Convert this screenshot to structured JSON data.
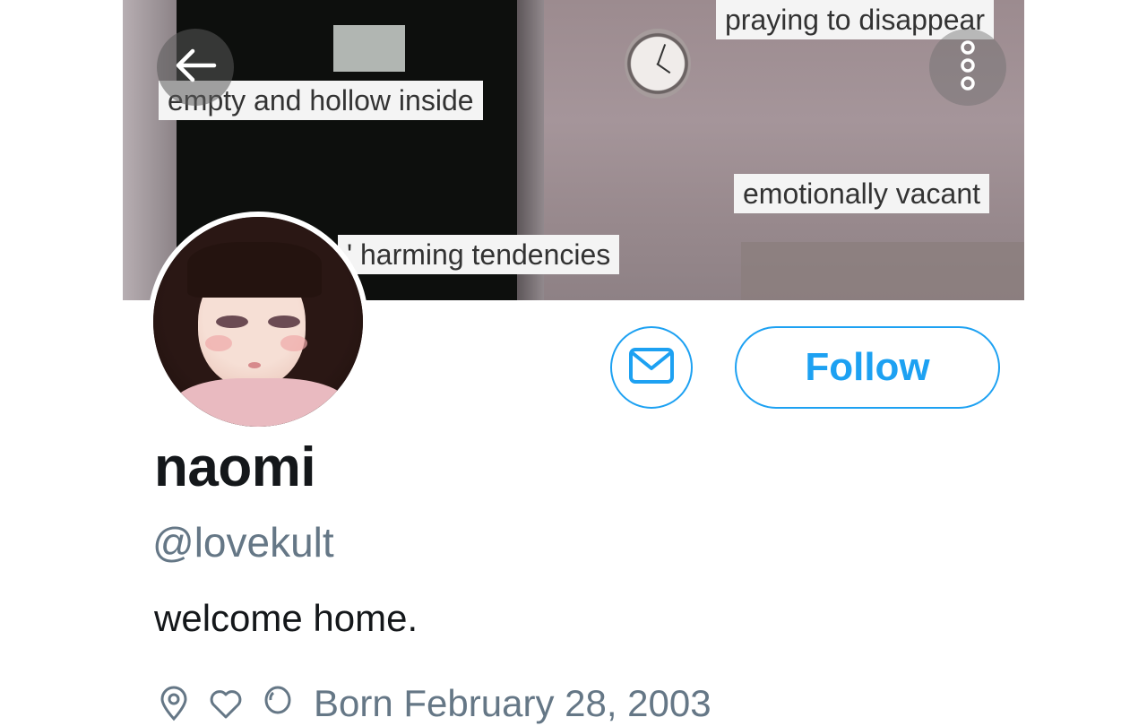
{
  "header": {
    "captions": [
      "empty and hollow inside",
      "praying to disappear",
      "emotionally vacant",
      "' harming tendencies"
    ]
  },
  "icons": {
    "back": "arrow-left-icon",
    "more": "vertical-ellipsis-icon",
    "message": "envelope-icon",
    "location": "location-pin-icon",
    "heart": "heart-icon",
    "birthday": "balloon-icon"
  },
  "actions": {
    "follow_label": "Follow"
  },
  "profile": {
    "display_name": "naomi",
    "handle": "@lovekult",
    "bio": "welcome home.",
    "born": "Born February 28, 2003"
  },
  "colors": {
    "accent": "#1da1f2",
    "secondary_text": "#657786",
    "primary_text": "#14171a"
  }
}
